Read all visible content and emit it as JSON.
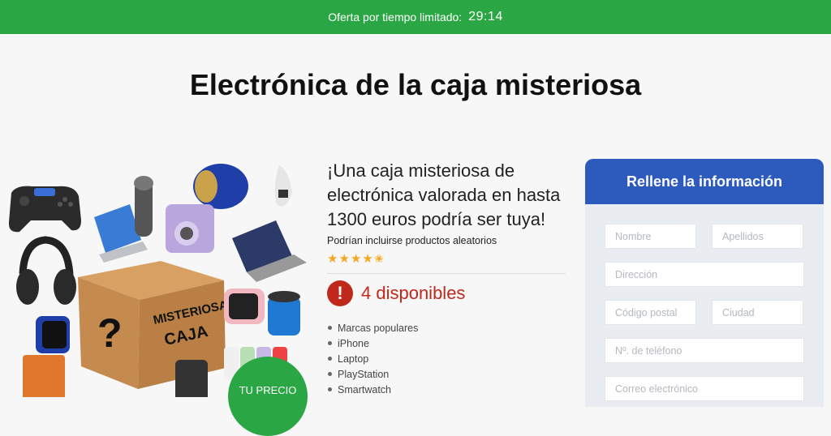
{
  "topbar": {
    "label": "Oferta por tiempo limitado:",
    "timer": "29:14",
    "color": "#2aa744"
  },
  "page": {
    "title": "Electrónica de la caja misteriosa"
  },
  "collage": {
    "box_text_1": "MISTERIOSA",
    "box_text_2": "CAJA",
    "box_symbol": "?"
  },
  "offer": {
    "headline": "¡Una caja misteriosa de electrónica valorada en hasta 1300 euros podría ser tuya!",
    "subline": "Podrían incluirse productos aleatorios",
    "rating": 4.5,
    "stars": "★★★★✬",
    "stock_icon": "!",
    "stock_text": "4 disponibles",
    "stock_color": "#c0281c",
    "features": [
      "Marcas populares",
      "iPhone",
      "Laptop",
      "PlayStation",
      "Smartwatch"
    ]
  },
  "price_badge": {
    "label": "TU PRECIO"
  },
  "form": {
    "title": "Rellene la información",
    "header_color": "#2d5bbd",
    "fields": {
      "first_name": "Nombre",
      "last_name": "Apellidos",
      "address": "Dirección",
      "postal_code": "Código postal",
      "city": "Ciudad",
      "phone": "Nº. de teléfono",
      "email": "Correo electrónico"
    }
  }
}
